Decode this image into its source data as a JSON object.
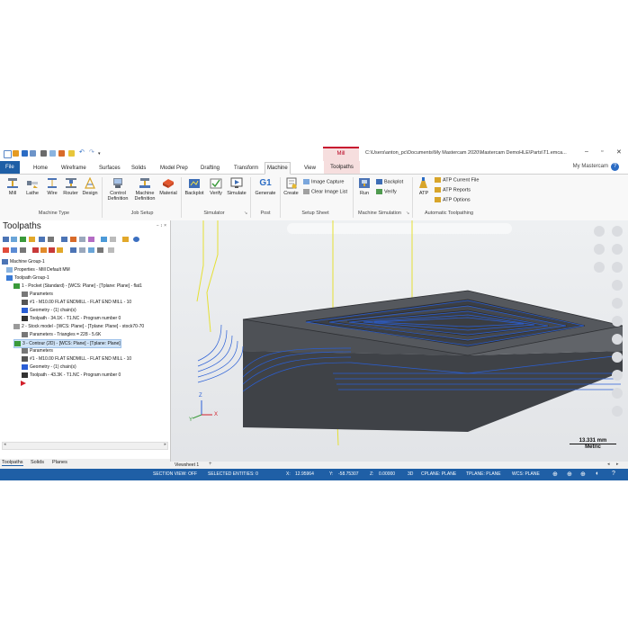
{
  "app": {
    "document_path": "C:\\Users\\anton_pc\\Documents\\My Mastercam 2020\\Mastercam DemoHLE\\Parts\\T1.emca...",
    "contextual_group": "Mill",
    "my_mastercam": "My Mastercam"
  },
  "tabs": [
    "File",
    "Home",
    "Wireframe",
    "Surfaces",
    "Solids",
    "Model Prep",
    "Drafting",
    "Transform",
    "Machine",
    "View",
    "Toolpaths"
  ],
  "ribbon": {
    "machine_type": {
      "label": "Machine Type",
      "buttons": [
        "Mill",
        "Lathe",
        "Wire",
        "Router",
        "Design"
      ]
    },
    "job_setup": {
      "label": "Job Setup",
      "buttons": [
        "Control Definition",
        "Machine Definition",
        "Material"
      ]
    },
    "simulator": {
      "label": "Simulator",
      "buttons": [
        "Backplot",
        "Verify",
        "Simulate"
      ]
    },
    "post": {
      "label": "Post",
      "buttons": [
        "Generate"
      ],
      "g1": "G1"
    },
    "setup_sheet": {
      "label": "Setup Sheet",
      "create": "Create",
      "items": [
        "Image Capture",
        "Clear Image List"
      ]
    },
    "machine_simulation": {
      "label": "Machine Simulation",
      "run": "Run",
      "items": [
        "Backplot",
        "Verify"
      ]
    },
    "automatic_toolpathing": {
      "label": "Automatic Toolpathing",
      "atp": "ATP",
      "items": [
        "ATP Current File",
        "ATP Reports",
        "ATP Options"
      ]
    }
  },
  "toolpaths_panel": {
    "title": "Toolpaths",
    "pin": "− ↕ ×",
    "tree": [
      "Machine Group-1",
      "Properties - Mill Default MM",
      "Toolpath Group-1",
      "1 - Pocket (Standard) - [WCS: Plane] - [Tplane: Plane] - flat1",
      "Parameters",
      "#1 - M10.00 FLAT ENDMILL - FLAT END MILL - 10",
      "Geometry - (1) chain(s)",
      "Toolpath - 34.1K - T1.NC - Program number 0",
      "2 - Stock model - [WCS: Plane] - [Tplane: Plane] - stock70-70",
      "Parameters - Triangles = 228 - 5.6K",
      "3 - Contour (2D) - [WCS: Plane] - [Tplane: Plane]",
      "Parameters",
      "#1 - M10.00 FLAT ENDMILL - FLAT END MILL - 10",
      "Geometry - (1) chain(s)",
      "Toolpath - 43.3K - T1.NC - Program number 0"
    ],
    "bottom_tabs": [
      "Toolpaths",
      "Solids",
      "Planes"
    ]
  },
  "viewport": {
    "scale_value": "13.331 mm",
    "scale_unit": "Metric",
    "viewsheet": "Viewsheet 1",
    "add_tab": "+",
    "axis_x": "X",
    "axis_y": "Y",
    "axis_z": "Z"
  },
  "status": {
    "section_view": "SECTION VIEW: OFF",
    "selected": "SELECTED ENTITIES: 0",
    "x_label": "X:",
    "x": "12.95964",
    "y_label": "Y:",
    "y": "-58.75307",
    "z_label": "Z:",
    "z": "0.00000",
    "mode": "3D",
    "cplane": "CPLANE: PLANE",
    "tplane": "TPLANE: PLANE",
    "wcs": "WCS: PLANE"
  },
  "colors": {
    "accent": "#1f5fa6",
    "context": "#c8102e",
    "toolpath": "#2a5fd6",
    "wire": "#e5e033",
    "model": "#4a4d52"
  }
}
